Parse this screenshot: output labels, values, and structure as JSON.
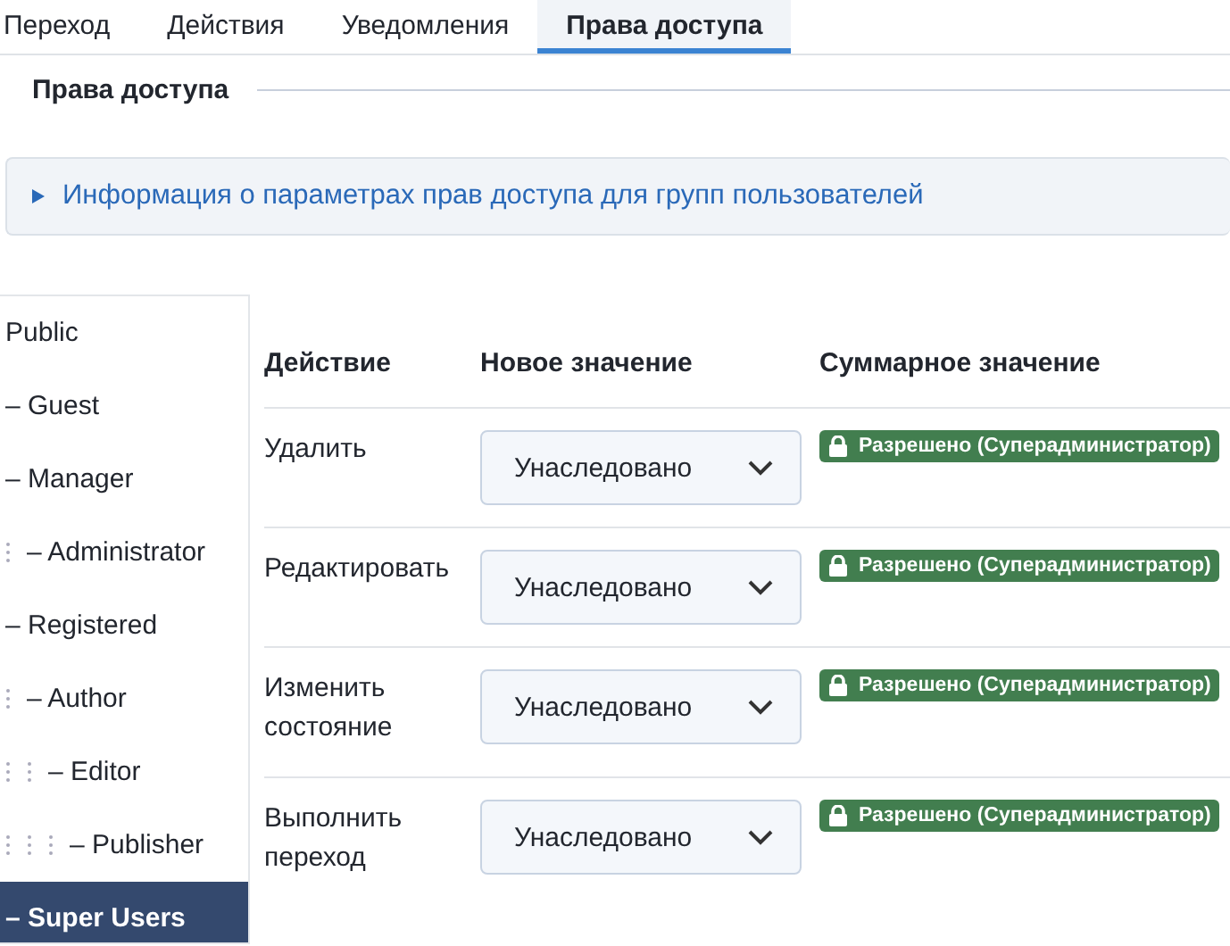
{
  "tabs": [
    {
      "label": "Переход",
      "selected": false
    },
    {
      "label": "Действия",
      "selected": false
    },
    {
      "label": "Уведомления",
      "selected": false
    },
    {
      "label": "Права доступа",
      "selected": true
    }
  ],
  "legend": "Права доступа",
  "info": {
    "label": "Информация о параметрах прав доступа для групп пользователей",
    "expanded": false
  },
  "groups": [
    {
      "label": "Public",
      "selected": false,
      "children": [
        {
          "label": "– Guest",
          "selected": false
        },
        {
          "label": "– Manager",
          "selected": false,
          "children": [
            {
              "label": "– Administrator",
              "selected": false
            }
          ]
        },
        {
          "label": "– Registered",
          "selected": false,
          "children": [
            {
              "label": "– Author",
              "selected": false,
              "children": [
                {
                  "label": "– Editor",
                  "selected": false,
                  "children": [
                    {
                      "label": "– Publisher",
                      "selected": false
                    }
                  ]
                }
              ]
            }
          ]
        },
        {
          "label": "– Super Users",
          "selected": true
        }
      ]
    }
  ],
  "table": {
    "columns": [
      "Действие",
      "Новое значение",
      "Суммарное значение"
    ],
    "rows": [
      {
        "action": "Удалить",
        "value": "Унаследовано",
        "result": "Разрешено (Суперадминистратор)",
        "locked": true
      },
      {
        "action": "Редактировать",
        "value": "Унаследовано",
        "result": "Разрешено (Суперадминистратор)",
        "locked": true
      },
      {
        "action": "Изменить состояние",
        "value": "Унаследовано",
        "result": "Разрешено (Суперадминистратор)",
        "locked": true
      },
      {
        "action": "Выполнить переход",
        "value": "Унаследовано",
        "result": "Разрешено (Суперадминистратор)",
        "locked": true
      }
    ]
  }
}
